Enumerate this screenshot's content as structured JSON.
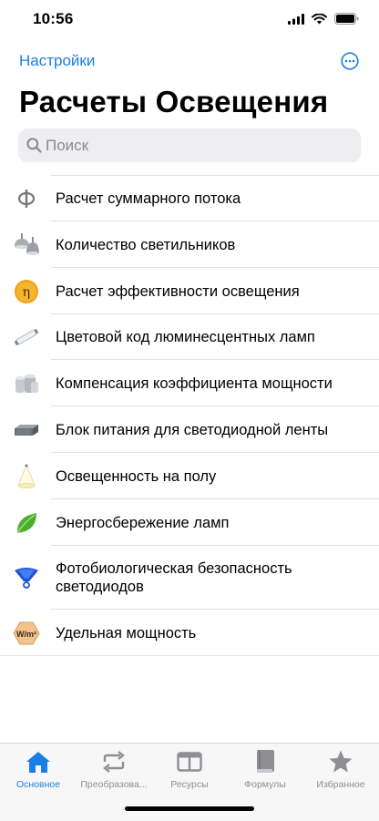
{
  "status": {
    "time": "10:56"
  },
  "nav": {
    "back_label": "Настройки",
    "title": "Расчеты Освещения"
  },
  "search": {
    "placeholder": "Поиск"
  },
  "items": [
    {
      "label": "Расчет суммарного потока",
      "icon": "phi-icon"
    },
    {
      "label": "Количество светильников",
      "icon": "ceiling-lamps-icon"
    },
    {
      "label": "Расчет эффективности освещения",
      "icon": "eta-icon"
    },
    {
      "label": "Цветовой код люминесцентных ламп",
      "icon": "fluorescent-tube-icon"
    },
    {
      "label": "Компенсация коэффициента мощности",
      "icon": "capacitor-icon"
    },
    {
      "label": "Блок питания для светодиодной ленты",
      "icon": "power-supply-icon"
    },
    {
      "label": "Освещенность на полу",
      "icon": "light-cone-icon"
    },
    {
      "label": "Энергосбережение ламп",
      "icon": "leaf-icon"
    },
    {
      "label": "Фотобиологическая безопасность светодиодов",
      "icon": "led-icon"
    },
    {
      "label": "Удельная мощность",
      "icon": "wm2-icon",
      "icon_text": "W/m²"
    }
  ],
  "tabs": [
    {
      "label": "Основное",
      "icon": "house-icon",
      "active": true
    },
    {
      "label": "Преобразова...",
      "icon": "convert-icon",
      "active": false
    },
    {
      "label": "Ресурсы",
      "icon": "resources-icon",
      "active": false
    },
    {
      "label": "Формулы",
      "icon": "book-icon",
      "active": false
    },
    {
      "label": "Избранное",
      "icon": "star-icon",
      "active": false
    }
  ],
  "colors": {
    "accent": "#1a7ee6",
    "inactive": "#8e8e93"
  }
}
